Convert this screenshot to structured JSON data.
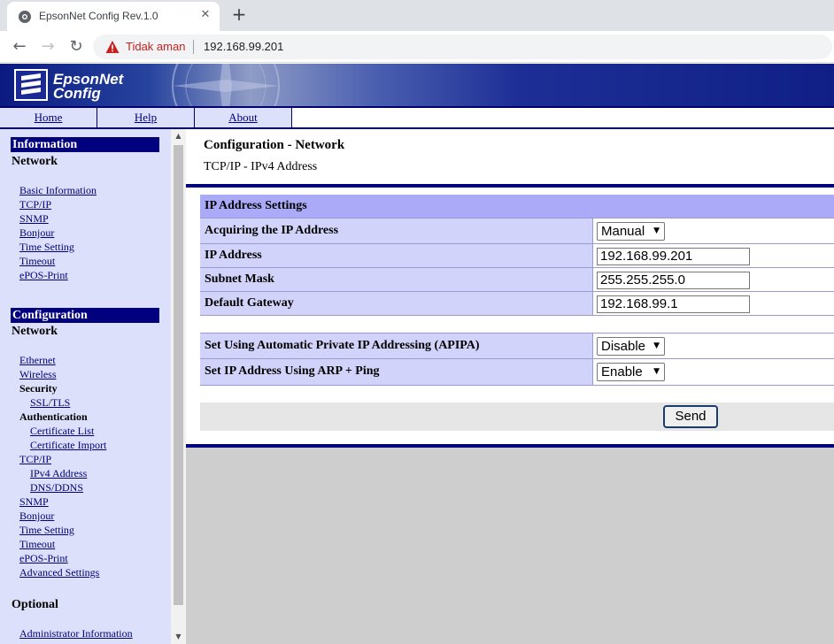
{
  "browser": {
    "tab_title": "EpsonNet Config Rev.1.0",
    "tab_close": "✕",
    "new_tab": "+",
    "insecure_label": "Tidak aman",
    "url": "192.168.99.201"
  },
  "header": {
    "logo_line1": "EpsonNet",
    "logo_line2": "Config",
    "menu": [
      "Home",
      "Help",
      "About"
    ]
  },
  "sidebar": {
    "info_heading": "Information",
    "info_sub": "Network",
    "info_links": [
      "Basic Information",
      "TCP/IP",
      "SNMP",
      "Bonjour",
      "Time Setting",
      "Timeout",
      "ePOS-Print"
    ],
    "config_heading": "Configuration",
    "config_sub": "Network",
    "config_items": [
      {
        "label": "Ethernet"
      },
      {
        "label": "Wireless"
      },
      {
        "label": "Security"
      },
      {
        "label": "SSL/TLS"
      },
      {
        "label": "Authentication"
      },
      {
        "label": "Certificate List"
      },
      {
        "label": "Certificate Import"
      },
      {
        "label": "TCP/IP"
      },
      {
        "label": "IPv4 Address"
      },
      {
        "label": "DNS/DDNS"
      },
      {
        "label": "SNMP"
      },
      {
        "label": "Bonjour"
      },
      {
        "label": "Time Setting"
      },
      {
        "label": "Timeout"
      },
      {
        "label": "ePOS-Print"
      },
      {
        "label": "Advanced Settings"
      }
    ],
    "optional_heading": "Optional",
    "optional_links": [
      "Administrator Information"
    ]
  },
  "main": {
    "title": "Configuration - Network",
    "subtitle": "TCP/IP - IPv4 Address",
    "section_header": "IP Address Settings",
    "rows": [
      {
        "label": "Acquiring the IP Address",
        "value": "Manual"
      },
      {
        "label": "IP Address",
        "value": "192.168.99.201"
      },
      {
        "label": "Subnet Mask",
        "value": "255.255.255.0"
      },
      {
        "label": "Default Gateway",
        "value": "192.168.99.1"
      },
      {
        "label": "Set Using Automatic Private IP Addressing (APIPA)",
        "value": "Disable"
      },
      {
        "label": "Set IP Address Using ARP + Ping",
        "value": "Enable"
      }
    ],
    "send_label": "Send"
  }
}
